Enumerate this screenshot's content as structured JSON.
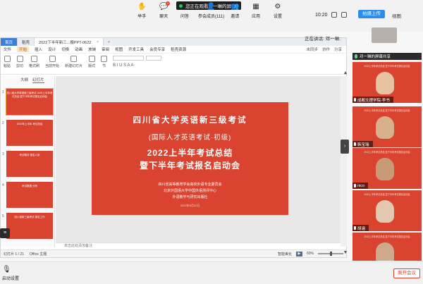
{
  "meeting": {
    "share_status": "您正在观看邓一琳的屏幕",
    "clock": "10:20",
    "upload_label": "拍摄上传",
    "view_label": "视图",
    "speaking_label": "正在讲话: 邓一琳;",
    "share_label": "邓一琳的屏幕共享"
  },
  "wps": {
    "tabs": [
      {
        "label": "首页"
      },
      {
        "label": "稻壳"
      },
      {
        "label": "2022下半年新三...报PPT-0622"
      }
    ],
    "add_tab": "+",
    "menu": [
      "文件",
      "开始",
      "插入",
      "设计",
      "切换",
      "动画",
      "放映",
      "审阅",
      "视图",
      "开发工具",
      "会员专享",
      "稻壳资源"
    ],
    "menu_active": "开始",
    "menu_right": [
      "未同步",
      "协作",
      "分享"
    ],
    "ribbon": [
      "粘贴",
      "剪切",
      "格式刷",
      "当前开始",
      "新建幻灯片",
      "版式",
      "节"
    ],
    "format_glyphs": "B I U S A A",
    "panel_tabs": [
      "大纲",
      "幻灯片"
    ],
    "status_left": "幻灯片 1 / 21",
    "status_theme": "Office 主题",
    "status_zoom": "60%",
    "notes_placeholder": "单击此处添加备注",
    "status_right": "智能美化",
    "fab_icon": "≡"
  },
  "slide": {
    "title": "四川省大学英语新三级考试",
    "subtitle": "(国际人才英语考试·初级)",
    "heading1": "2022上半年考试总结",
    "heading2": "暨下半年考试报名启动会",
    "org1": "四川省高等教育学会高校外语专业委员会",
    "org2": "北京外国语大学中国外语测评中心",
    "org3": "外语教学与研究出版社",
    "date": "2022年6月22日"
  },
  "thumbs": [
    {
      "num": "1",
      "text": "四川省大学英语新三级考试 2022上半年考试总结 暨下半年考试报名启动会"
    },
    {
      "num": "2",
      "text": "2022年上半年 考试总结"
    },
    {
      "num": "3",
      "text": "考试概况 报名人数"
    },
    {
      "num": "4",
      "text": "考试数据 分析"
    },
    {
      "num": "5",
      "text": "四川省新三级考试 报名工作"
    }
  ],
  "participants": [
    {
      "name": "成都文理学院-李书",
      "face": "#e7c3a2"
    },
    {
      "name": "韩宝瑞",
      "face": "#d8b08c"
    },
    {
      "name": "nico",
      "face": "#c99a78"
    },
    {
      "name": "胡涵",
      "face": "#e4c7b0"
    },
    {
      "name": "",
      "face": "#cfa98c"
    }
  ],
  "tile_slide_text": "2022上半年考试总结 暨下半年考试报名启动会",
  "toolbar": [
    {
      "label": "举手",
      "icon": "✋"
    },
    {
      "label": "聊天",
      "icon": "💬",
      "badge": "1"
    },
    {
      "label": "问答",
      "icon": "?"
    },
    {
      "label": "参会成员(111)",
      "icon": "👤"
    },
    {
      "label": "邀请",
      "icon": "👥"
    },
    {
      "label": "应用",
      "icon": "▦"
    },
    {
      "label": "设置",
      "icon": "⚙"
    }
  ],
  "mic_label": "启动设置",
  "leave_label": "离开会议"
}
